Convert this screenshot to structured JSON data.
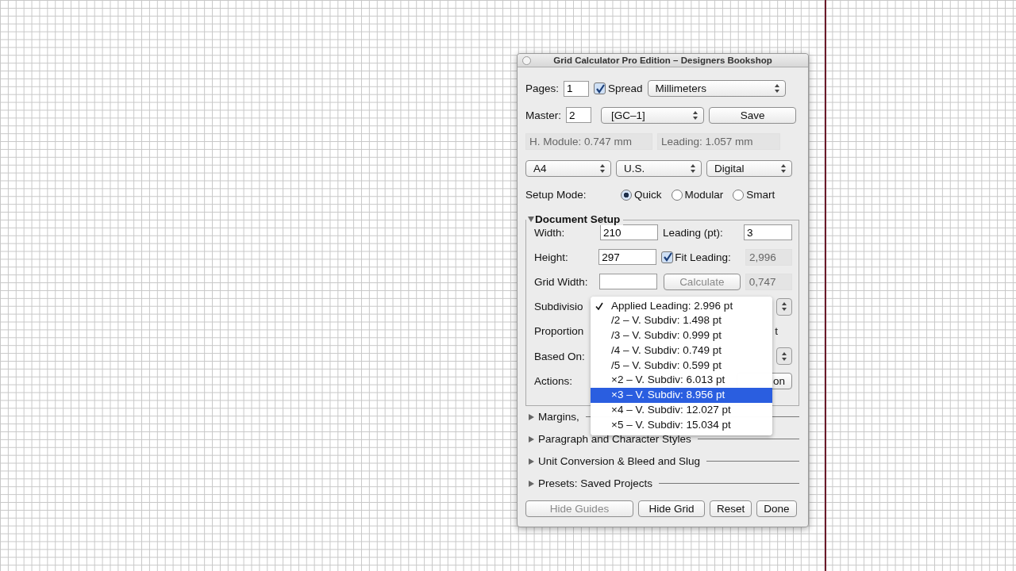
{
  "window": {
    "title": "Grid Calculator Pro Edition – Designers Bookshop"
  },
  "pages": {
    "label": "Pages:",
    "value": "1"
  },
  "spread": {
    "label": "Spread",
    "checked": true
  },
  "units": "Millimeters",
  "master": {
    "label": "Master:",
    "value": "2"
  },
  "master_popup": "[GC–1]",
  "save_button": "Save",
  "readouts": [
    "H. Module: 0.747 mm",
    "Leading: 1.057 mm"
  ],
  "popups": [
    "A4",
    "U.S.",
    "Digital"
  ],
  "setup_mode": {
    "label": "Setup Mode:",
    "options": [
      {
        "label": "Quick",
        "selected": true
      },
      {
        "label": "Modular",
        "selected": false
      },
      {
        "label": "Smart",
        "selected": false
      }
    ]
  },
  "document_setup": {
    "title": "Document Setup",
    "expanded": true,
    "width": {
      "label": "Width:",
      "value": "210"
    },
    "leading_pt": {
      "label": "Leading (pt):",
      "value": "3"
    },
    "height": {
      "label": "Height:",
      "value": "297"
    },
    "fit_leading": {
      "label": "Fit Leading:",
      "checked": true,
      "value": "2,996"
    },
    "grid_width": {
      "label": "Grid Width:",
      "button": "Calculate",
      "value": "0,747"
    },
    "subdivision": {
      "label": "Subdivisio"
    },
    "proportion": {
      "label": "Proportion",
      "tail": "t"
    },
    "based_on": {
      "label": "Based On:"
    },
    "actions": {
      "label": "Actions:",
      "button": "on"
    }
  },
  "menu": [
    {
      "label": "Applied Leading: 2.996 pt",
      "checked": true,
      "selected": false
    },
    {
      "label": "/2 – V. Subdiv: 1.498 pt",
      "checked": false,
      "selected": false
    },
    {
      "label": "/3 – V. Subdiv: 0.999 pt",
      "checked": false,
      "selected": false
    },
    {
      "label": "/4 – V. Subdiv: 0.749 pt",
      "checked": false,
      "selected": false
    },
    {
      "label": "/5 – V. Subdiv: 0.599 pt",
      "checked": false,
      "selected": false
    },
    {
      "label": "×2 – V. Subdiv: 6.013 pt",
      "checked": false,
      "selected": false
    },
    {
      "label": "×3 – V. Subdiv: 8.956 pt",
      "checked": false,
      "selected": true
    },
    {
      "label": "×4 – V. Subdiv: 12.027 pt",
      "checked": false,
      "selected": false
    },
    {
      "label": "×5 – V. Subdiv: 15.034 pt",
      "checked": false,
      "selected": false
    }
  ],
  "sections": [
    {
      "title": "Margins,",
      "expanded": false
    },
    {
      "title": "Paragraph and Character Styles",
      "expanded": false
    },
    {
      "title": "Unit Conversion & Bleed and Slug",
      "expanded": false
    },
    {
      "title": "Presets: Saved Projects",
      "expanded": false
    }
  ],
  "buttons": [
    {
      "label": "Hide Guides",
      "disabled": true
    },
    {
      "label": "Hide Grid",
      "disabled": false
    },
    {
      "label": "Reset",
      "disabled": false
    },
    {
      "label": "Done",
      "disabled": false
    }
  ]
}
